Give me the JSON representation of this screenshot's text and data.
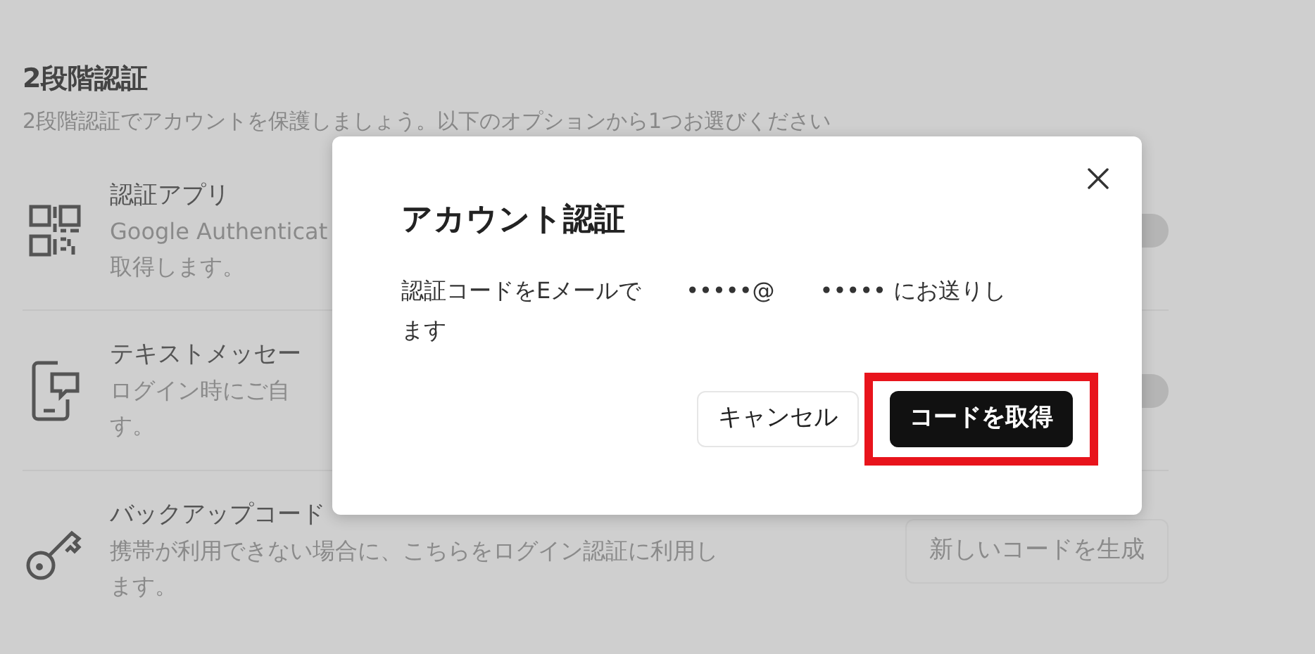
{
  "page": {
    "title": "2段階認証",
    "subtitle": "2段階認証でアカウントを保護しましょう。以下のオプションから1つお選びください"
  },
  "methods": [
    {
      "kind": "app",
      "title": "認証アプリ",
      "lines": [
        "Google Authenticat",
        "取得します。"
      ],
      "control": {
        "kind": "toggle",
        "on": false
      }
    },
    {
      "kind": "sms",
      "title": "テキストメッセー",
      "lines": [
        "ログイン時にご自",
        "す。"
      ],
      "control": {
        "kind": "toggle",
        "on": false
      }
    },
    {
      "kind": "backup",
      "title": "バックアップコード",
      "lines": [
        "携帯が利用できない場合に、こちらをログイン認証に利用し",
        "ます。"
      ],
      "control": {
        "kind": "button",
        "label": "新しいコードを生成",
        "disabled": true
      }
    }
  ],
  "dialog": {
    "title": "アカウント認証",
    "message": "認証コードをEメールで　　•••••@　　••••• にお送りします",
    "buttons": [
      {
        "label": "キャンセル",
        "kind": "secondary",
        "highlighted": false
      },
      {
        "label": "コードを取得",
        "kind": "primary",
        "highlighted": true
      }
    ]
  }
}
